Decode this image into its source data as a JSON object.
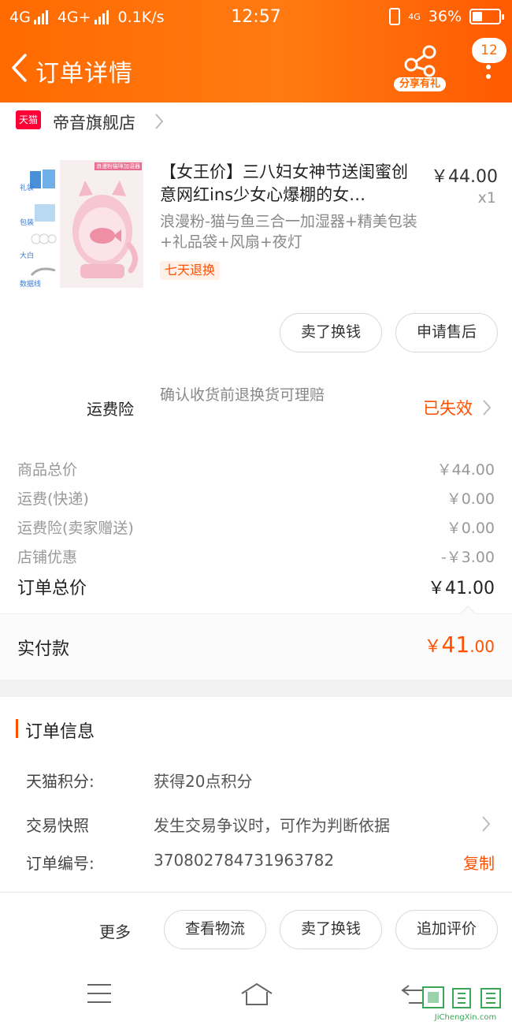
{
  "status_bar": {
    "network1": "4G",
    "network2": "4G+",
    "speed": "0.1K/s",
    "time": "12:57",
    "net_badge": "4G",
    "battery": "36%"
  },
  "nav": {
    "title": "订单详情",
    "share_label": "分享有礼",
    "message_count": "12"
  },
  "shop": {
    "logo_text": "天猫",
    "name": "帝音旗舰店"
  },
  "product": {
    "thumb_banner": "浪漫粉猫咪加湿器",
    "thumb_labels": [
      "礼袋",
      "包装",
      "大白",
      "数据线"
    ],
    "title": "【女王价】三八妇女神节送闺蜜创意网红ins少女心爆棚的女…",
    "price": "￥44.00",
    "quantity": "x1",
    "sku": "浪漫粉-猫与鱼三合一加湿器+精美包装+礼品袋+风扇+夜灯",
    "return_tag": "七天退换"
  },
  "item_actions": {
    "resell": "卖了换钱",
    "after_sale": "申请售后"
  },
  "insurance": {
    "label": "运费险",
    "description": "确认收货前退换货可理赔",
    "status": "已失效"
  },
  "price_details": [
    {
      "label": "商品总价",
      "value": "￥44.00"
    },
    {
      "label": "运费(快递)",
      "value": "￥0.00"
    },
    {
      "label": "运费险(卖家赠送)",
      "value": "￥0.00"
    },
    {
      "label": "店铺优惠",
      "value": "-￥3.00"
    }
  ],
  "order_total": {
    "label": "订单总价",
    "value": "￥41.00"
  },
  "paid": {
    "label": "实付款",
    "currency": "￥",
    "integer": "41",
    "decimal": ".00"
  },
  "order_info": {
    "title": "订单信息",
    "rows": [
      {
        "key": "天猫积分:",
        "value": "获得20点积分"
      },
      {
        "key": "交易快照",
        "value": "发生交易争议时，可作为判断依据"
      },
      {
        "key": "订单编号:",
        "value": "370802784731963782",
        "action": "复制"
      }
    ]
  },
  "bottom_actions": {
    "more": "更多",
    "logistics": "查看物流",
    "resell": "卖了换钱",
    "review": "追加评价"
  },
  "watermark": {
    "text": "JiChengXin.com"
  },
  "colors": {
    "primary": "#ff6a00",
    "accent_text": "#ff5000",
    "tmall_red": "#ff0036"
  }
}
